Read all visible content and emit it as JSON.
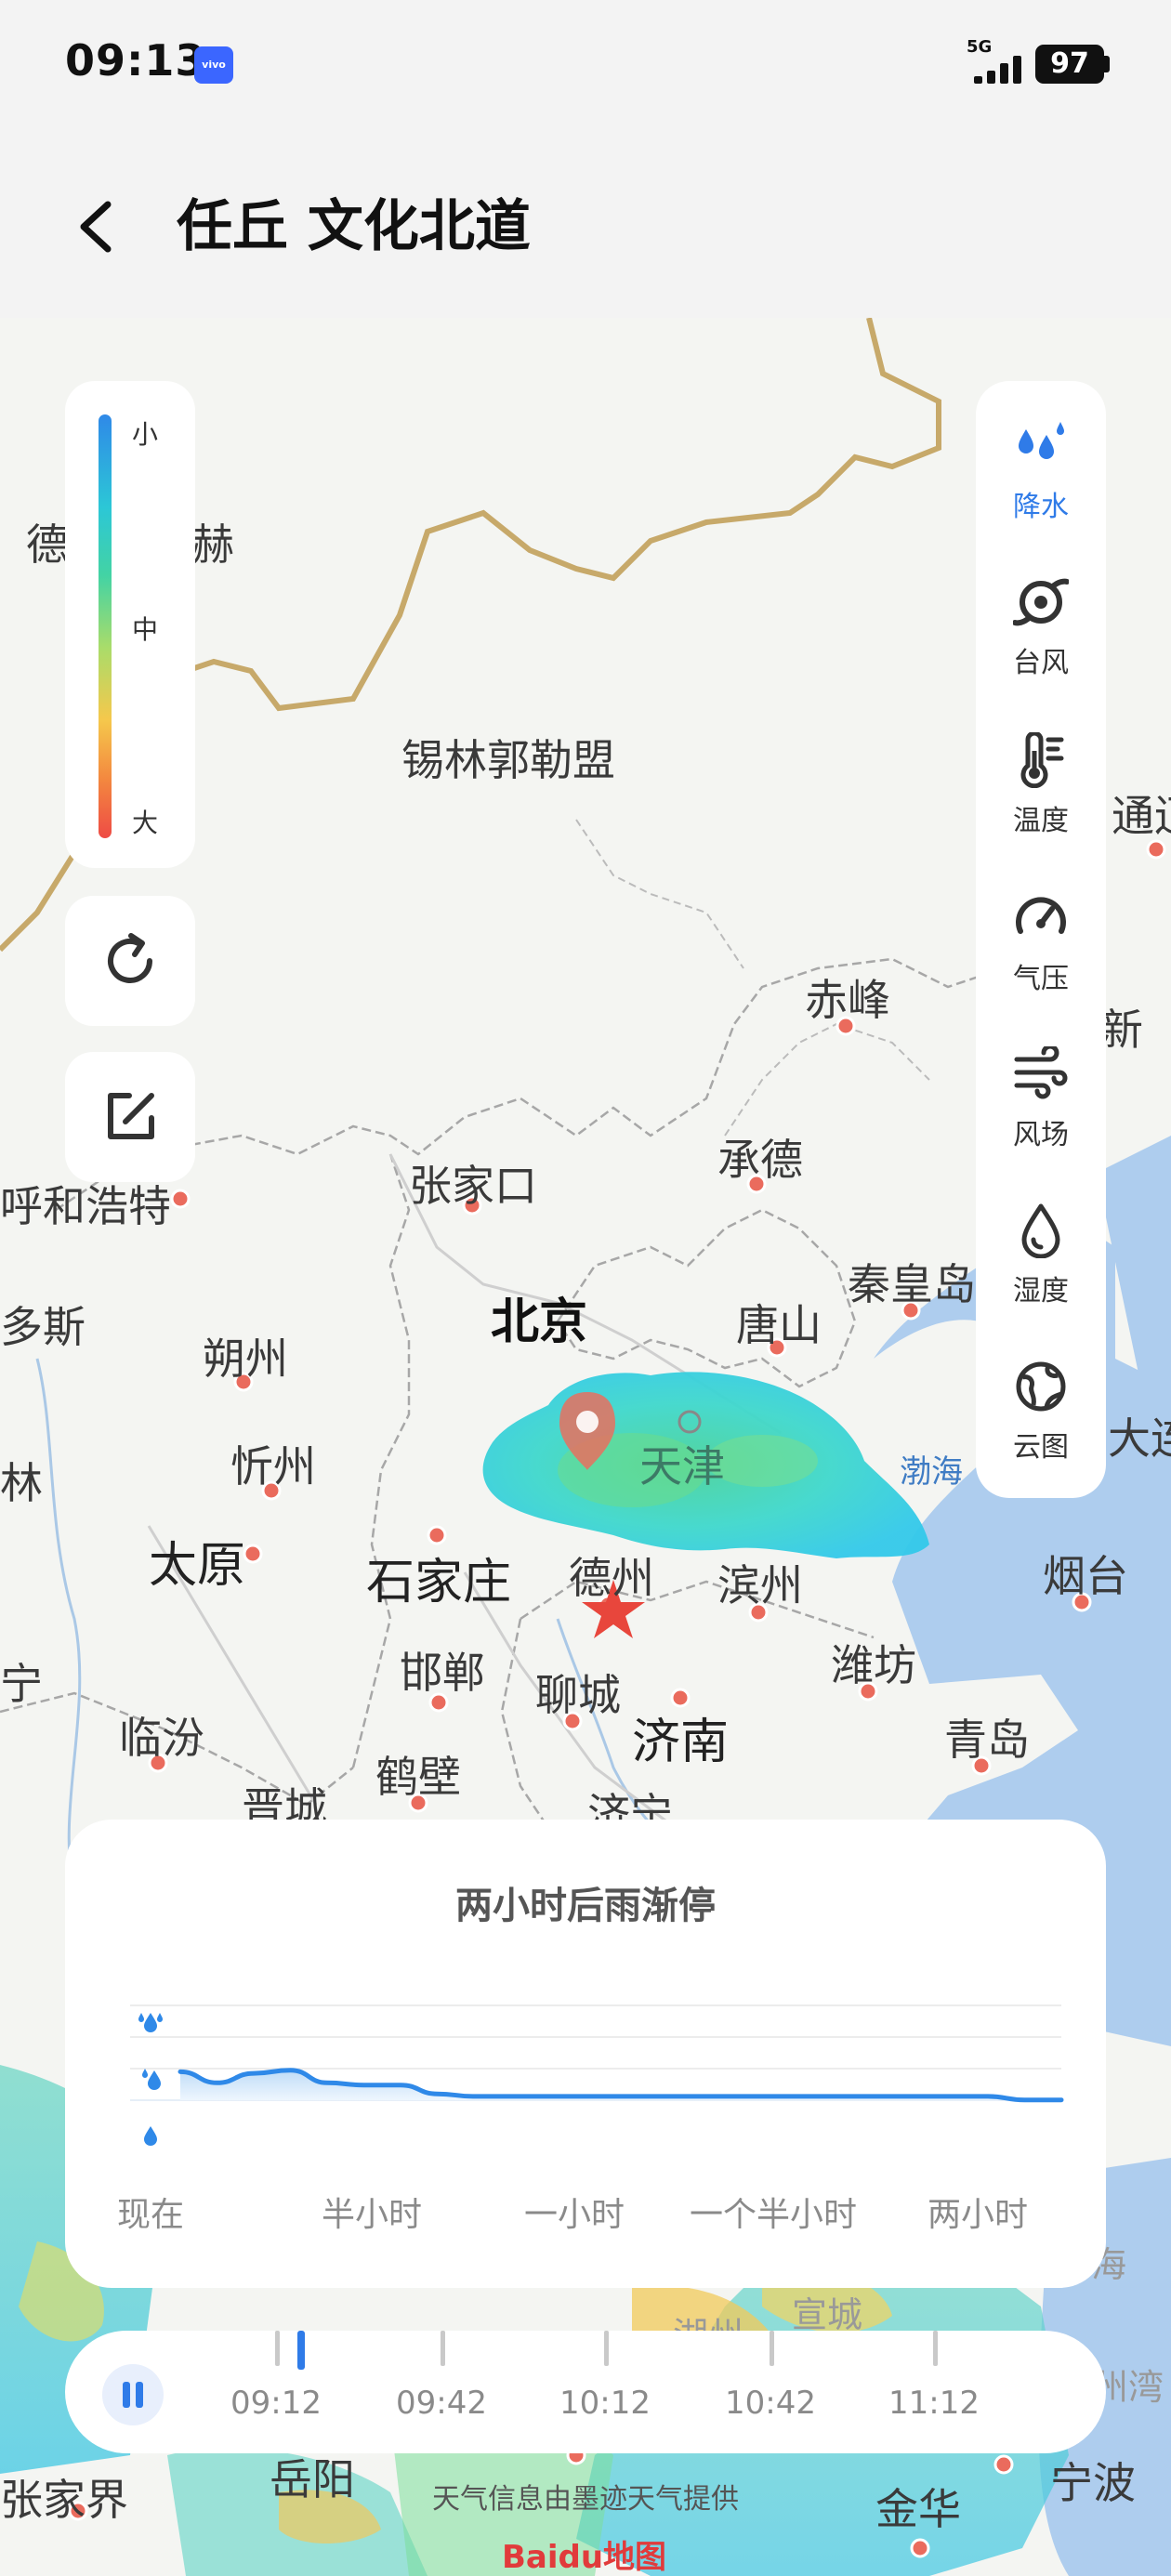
{
  "status_bar": {
    "time": "09:13",
    "brand_chip": "vivo",
    "network": "5G",
    "battery": "97"
  },
  "header": {
    "title": "任丘 文化北道"
  },
  "legend": {
    "low": "小",
    "mid": "中",
    "high": "大"
  },
  "layers": [
    {
      "label": "降水",
      "icon": "rain-drops-icon",
      "active": true
    },
    {
      "label": "台风",
      "icon": "typhoon-icon",
      "active": false
    },
    {
      "label": "温度",
      "icon": "thermometer-icon",
      "active": false
    },
    {
      "label": "气压",
      "icon": "gauge-icon",
      "active": false
    },
    {
      "label": "风场",
      "icon": "wind-icon",
      "active": false
    },
    {
      "label": "湿度",
      "icon": "humidity-drop-icon",
      "active": false
    },
    {
      "label": "云图",
      "icon": "globe-icon",
      "active": false
    }
  ],
  "map": {
    "cities": {
      "xilin": "锡林郭勒盟",
      "de": "德",
      "he": "赫",
      "chifeng": "赤峰",
      "tongliao": "通辽",
      "chengde": "承德",
      "zhangjiakou": "张家口",
      "huhehaote": "呼和浩特",
      "beijing": "北京",
      "tangshan": "唐山",
      "qinhuangdao": "秦皇岛",
      "xin": "新",
      "duosi": "多斯",
      "shuozhou": "朔州",
      "xinzhou": "忻州",
      "tianjin": "天津",
      "bohai": "渤海",
      "dalian": "大连",
      "lin": "林",
      "taiyuan": "太原",
      "shijiazhuang": "石家庄",
      "dezhou": "德州",
      "binzhou": "滨州",
      "yantai": "烟台",
      "handan": "邯郸",
      "liaocheng": "聊城",
      "weifang": "潍坊",
      "linfen": "临汾",
      "jinan": "济南",
      "qingdao": "青岛",
      "jincheng": "晋城",
      "hebi": "鹤壁",
      "jining": "济宁",
      "anning": "宁",
      "zhangjiajie": "张家界",
      "yueyang": "岳阳",
      "jinhua": "金华",
      "ningbo": "宁波",
      "hai": "海",
      "zhouwan": "州湾",
      "xuancheng": "宣城",
      "huzhou": "湖州"
    }
  },
  "forecast": {
    "title": "两小时后雨渐停",
    "tick_labels": [
      "现在",
      "半小时",
      "一小时",
      "一个半小时",
      "两小时"
    ]
  },
  "chart_data": {
    "type": "area",
    "title": "两小时后雨渐停",
    "x_labels": [
      "现在",
      "半小时",
      "一小时",
      "一个半小时",
      "两小时"
    ],
    "x_minutes": [
      0,
      5,
      10,
      15,
      20,
      25,
      30,
      35,
      40,
      45,
      50,
      55,
      60,
      65,
      70,
      75,
      80,
      85,
      90,
      95,
      100,
      105,
      110,
      115,
      120
    ],
    "values": [
      0.9,
      0.55,
      0.85,
      0.95,
      0.55,
      0.48,
      0.48,
      0.2,
      0.12,
      0.12,
      0.12,
      0.12,
      0.12,
      0.12,
      0.12,
      0.12,
      0.12,
      0.12,
      0.12,
      0.12,
      0.12,
      0.12,
      0.12,
      0.01,
      0.01
    ],
    "y_levels": [
      "小",
      "中",
      "大"
    ],
    "ylim": [
      0,
      3
    ],
    "grid": true,
    "legend": "none"
  },
  "timeline": {
    "times": [
      "09:12",
      "09:42",
      "10:12",
      "10:42",
      "11:12"
    ],
    "progress": 0.07
  },
  "attribution": "天气信息由墨迹天气提供",
  "map_provider": "Baidu地图"
}
